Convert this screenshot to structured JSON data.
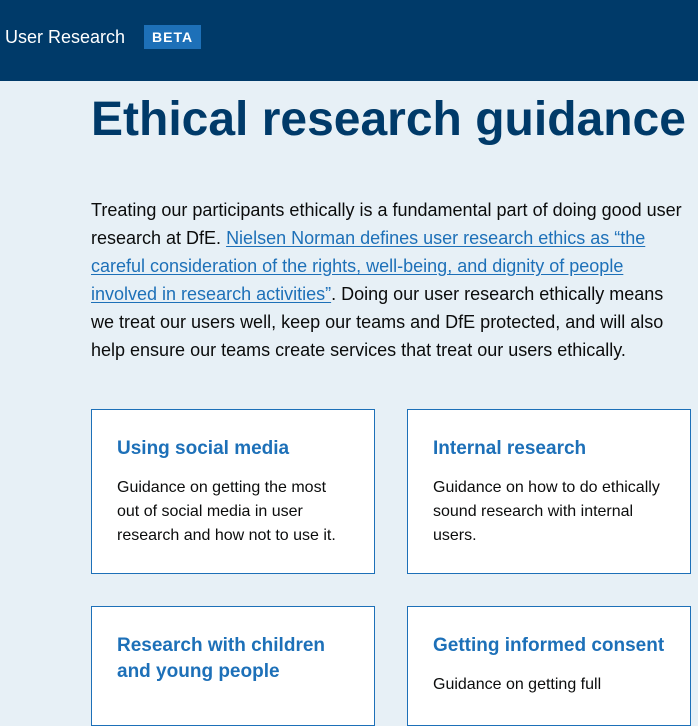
{
  "header": {
    "service_name": "User Research",
    "beta_tag": "BETA"
  },
  "main": {
    "title": "Ethical research guidance",
    "intro": {
      "text_before_link": "Treating our participants ethically is a fundamental part of doing good user research at DfE. ",
      "link_text": "Nielsen Norman defines user research ethics as “the careful consideration of the rights, well-being, and dignity of people involved in research activities”",
      "text_after_link": ". Doing our user research ethically means we treat our users well, keep our teams and DfE protected, and will also help ensure our teams create services that treat our users ethically."
    },
    "cards": [
      {
        "title": "Using social media",
        "description": "Guidance on getting the most out of social media in user research and how not to use it."
      },
      {
        "title": "Internal research",
        "description": "Guidance on how to do ethically sound research with internal users."
      },
      {
        "title": "Research with children and young people",
        "description": ""
      },
      {
        "title": "Getting informed consent",
        "description": "Guidance on getting full"
      }
    ]
  },
  "colors": {
    "header_bg": "#003a69",
    "page_bg": "#e7f0f6",
    "link": "#1d70b8",
    "title": "#003a69",
    "beta_tag_bg": "#1d70b8"
  }
}
